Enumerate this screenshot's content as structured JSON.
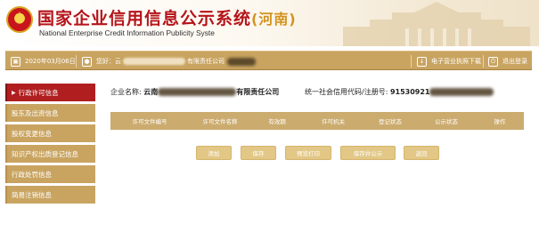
{
  "header": {
    "title_main": "国家企业信用信息公示系统",
    "title_province": "(河南)",
    "subtitle": "National Enterprise Credit Information Publicity Syste"
  },
  "toolbar": {
    "date": "2020年03月06日",
    "welcome_prefix": "您好：云",
    "welcome_suffix": "有限责任公司",
    "download_label": "电子营业执照下载",
    "logout_label": "退出登录"
  },
  "sidebar": {
    "items": [
      {
        "label": "行政许可信息",
        "active": true
      },
      {
        "label": "股东及出资信息",
        "active": false
      },
      {
        "label": "股权变更信息",
        "active": false
      },
      {
        "label": "知识产权出质登记信息",
        "active": false
      },
      {
        "label": "行政处罚信息",
        "active": false
      },
      {
        "label": "简易注销信息",
        "active": false
      }
    ]
  },
  "main": {
    "company_label": "企业名称:",
    "company_prefix": "云南",
    "company_suffix": "有限责任公司",
    "code_label": "统一社会信用代码/注册号:",
    "code_prefix": "91530921",
    "table": {
      "columns": [
        "许可文件编号",
        "许可文件名称",
        "有效期",
        "许可机关",
        "登记状态",
        "公示状态",
        "操作"
      ]
    },
    "buttons": [
      "添加",
      "保存",
      "预览打印",
      "保存并公示",
      "返回"
    ]
  },
  "colors": {
    "brand_red": "#b5141a",
    "gold": "#c9a461",
    "active_red": "#b01e1f",
    "button_gold": "#e2c786"
  }
}
